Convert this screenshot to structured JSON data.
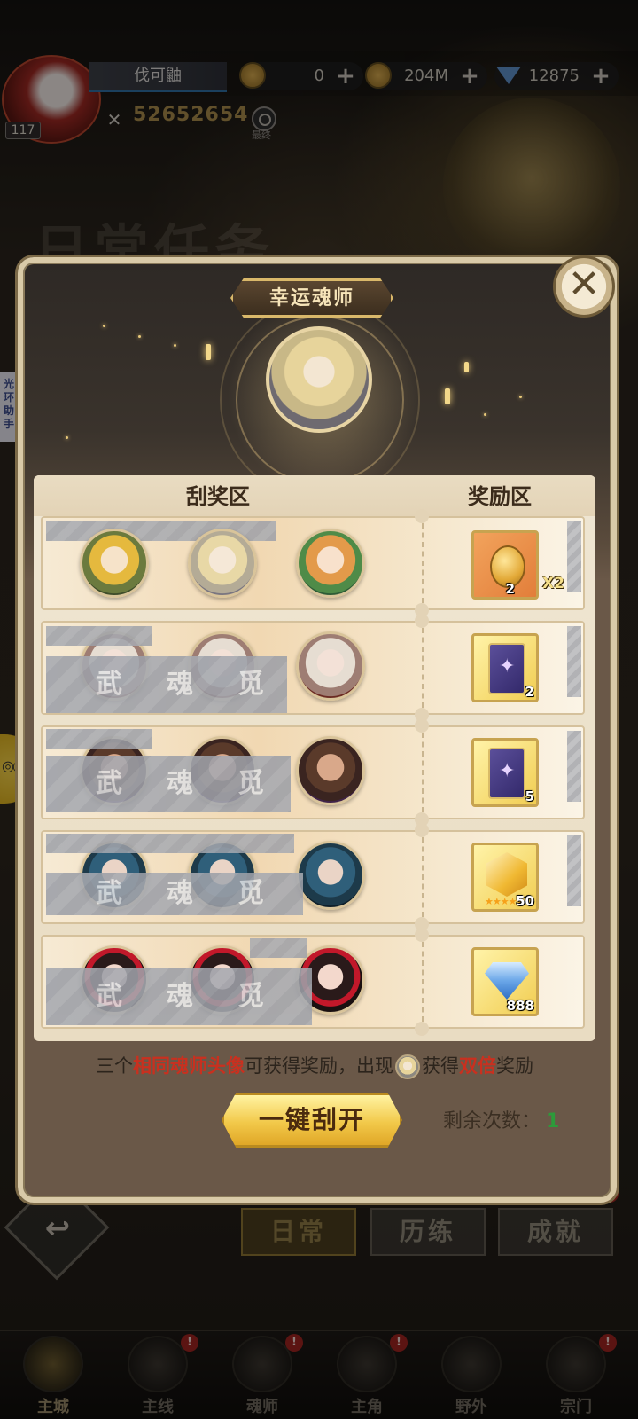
{
  "player": {
    "name": "伐可鼬",
    "level": "117",
    "power": "52652654",
    "search_caption": "最终"
  },
  "resources": [
    {
      "icon": "token-icon",
      "value": "0"
    },
    {
      "icon": "gold-coin-icon",
      "value": "204M"
    },
    {
      "icon": "diamond-icon",
      "value": "12875"
    }
  ],
  "background": {
    "title": "日常任务",
    "side_helper_label": [
      "光",
      "环",
      "助",
      "手"
    ],
    "tabs": [
      {
        "label": "日常",
        "active": true,
        "badge": "!"
      },
      {
        "label": "历练",
        "active": false,
        "badge": ""
      },
      {
        "label": "成就",
        "active": false,
        "badge": "!"
      }
    ]
  },
  "bottom_nav": [
    {
      "label": "主城",
      "icon": "castle-icon",
      "active": true,
      "badge": ""
    },
    {
      "label": "主线",
      "icon": "shield-icon",
      "active": false,
      "badge": "!"
    },
    {
      "label": "魂师",
      "icon": "book-icon",
      "active": false,
      "badge": "!"
    },
    {
      "label": "主角",
      "icon": "hood-icon",
      "active": false,
      "badge": "!"
    },
    {
      "label": "野外",
      "icon": "sword-icon",
      "active": false,
      "badge": ""
    },
    {
      "label": "宗门",
      "icon": "emblem-icon",
      "active": false,
      "badge": "!"
    }
  ],
  "modal": {
    "title": "幸运魂师",
    "scratch_zone_label": "刮奖区",
    "reward_zone_label": "奖励区",
    "rows": [
      {
        "portraits": [
          "blonde-girl-green-hood",
          "white-gold-haired-girl",
          "ginger-girl"
        ],
        "scratch_text": "",
        "reward": {
          "type": "gold-coin",
          "qty": "2",
          "multiplier": "X2"
        }
      },
      {
        "portraits": [
          "silver-haired-man",
          "silver-haired-man",
          "silver-haired-man"
        ],
        "scratch_text": "武魂觅",
        "reward": {
          "type": "purple-card",
          "qty": "2"
        }
      },
      {
        "portraits": [
          "bearded-man",
          "bearded-man",
          "bearded-man"
        ],
        "scratch_text": "武魂觅",
        "reward": {
          "type": "purple-card",
          "qty": "5"
        }
      },
      {
        "portraits": [
          "blue-haired-man",
          "blue-haired-man",
          "blue-haired-man"
        ],
        "scratch_text": "武魂觅",
        "reward": {
          "type": "gold-crystal",
          "qty": "50",
          "stars": "★★★★★"
        }
      },
      {
        "portraits": [
          "red-flower-girl",
          "red-flower-girl",
          "red-flower-girl"
        ],
        "scratch_text": "武魂觅",
        "reward": {
          "type": "blue-diamond",
          "qty": "888"
        }
      }
    ],
    "info": {
      "part1": "三个",
      "highlight1": "相同魂师头像",
      "part2": "可获得奖励，出现",
      "part3": "获得",
      "highlight2": "双倍",
      "part4": "奖励"
    },
    "scratch_all_button": "一键刮开",
    "remaining_label": "剩余次数：",
    "remaining_value": "1",
    "close_glyph": "✕"
  },
  "colors": {
    "accent_gold": "#d9b86a",
    "highlight_red": "#c9301f",
    "remaining_green": "#2d9a3a"
  }
}
